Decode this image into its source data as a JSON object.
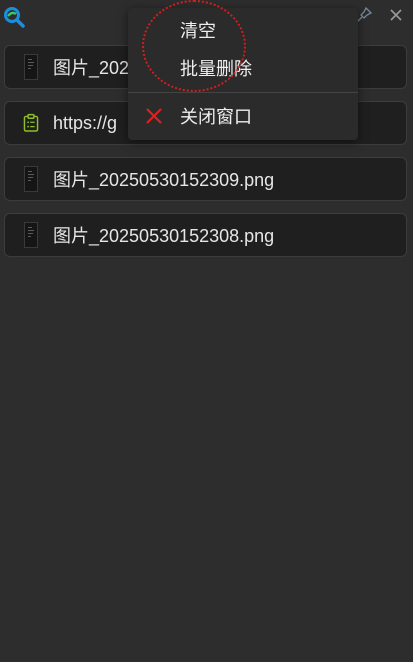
{
  "window": {
    "logo_icon": "magnifier-logo-icon",
    "pin_icon": "pin-icon",
    "close_icon": "close-icon"
  },
  "items": [
    {
      "type": "image",
      "icon": "image-thumbnail-icon",
      "label": "图片_2025"
    },
    {
      "type": "link",
      "icon": "clipboard-list-icon",
      "label": "https://g"
    },
    {
      "type": "image",
      "icon": "image-thumbnail-icon",
      "label": "图片_20250530152309.png"
    },
    {
      "type": "image",
      "icon": "image-thumbnail-icon",
      "label": "图片_20250530152308.png"
    }
  ],
  "context_menu": {
    "clear_label": "清空",
    "batch_delete_label": "批量删除",
    "close_window_label": "关闭窗口",
    "close_window_icon": "red-x-icon"
  },
  "colors": {
    "background": "#2d2d2d",
    "item_background": "#1f1f1f",
    "accent_green": "#8fbf2a",
    "danger_red": "#e02020",
    "logo_blue": "#1a8fe0"
  }
}
